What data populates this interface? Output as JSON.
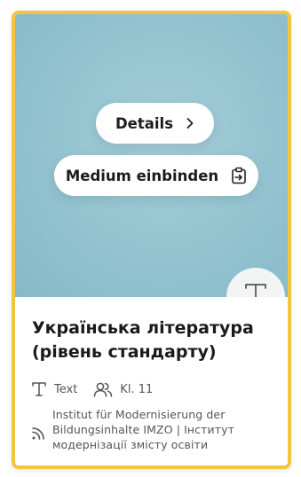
{
  "card": {
    "actions": {
      "details_label": "Details",
      "embed_label": "Medium einbinden"
    },
    "type_icon": "text-type-icon",
    "title": "Українська література (рівень стандарту)",
    "meta": {
      "type_label": "Text",
      "grade_label": "Kl. 11"
    },
    "publisher": "Institut für Modernisierung der Bildungsinhalte IMZO | Інститут модернізації змісту освіти"
  },
  "colors": {
    "frame_border": "#f2c443",
    "media_background": "#96c5d2",
    "badge_background": "#f3f4f4",
    "title_text": "#1a1a1a",
    "meta_text": "#555555"
  },
  "icons": [
    "chevron-right-icon",
    "clipboard-icon",
    "text-type-icon",
    "users-icon",
    "rss-feed-icon"
  ]
}
